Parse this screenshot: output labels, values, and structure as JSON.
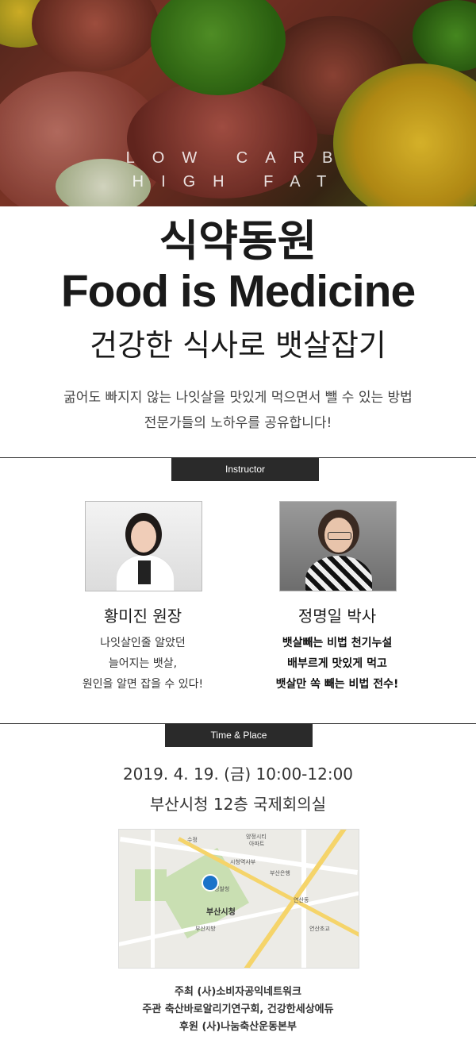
{
  "hero": {
    "line1": "LOW CARB",
    "line2": "HIGH FAT"
  },
  "title_ko": "식약동원",
  "title_en": "Food is Medicine",
  "subtitle": "건강한 식사로 뱃살잡기",
  "description": [
    "굶어도 빠지지 않는 나잇살을 맛있게 먹으면서 뺄 수 있는 방법",
    "전문가들의 노하우를 공유합니다!"
  ],
  "instructor_section": {
    "label": "Instructor",
    "instructors": [
      {
        "name": "황미진 원장",
        "bio": [
          "나잇살인줄 알았던",
          "늘어지는 뱃살,",
          "원인을 알면 잡을 수 있다!"
        ]
      },
      {
        "name": "정명일 박사",
        "bio": [
          "뱃살빼는 비법 천기누설",
          "배부르게 맛있게 먹고",
          "뱃살만 쏙 빼는 비법 전수!"
        ]
      }
    ]
  },
  "time_place_section": {
    "label": "Time & Place",
    "datetime": "2019. 4. 19. (금) 10:00-12:00",
    "place": "부산시청 12층 국제회의실"
  },
  "map": {
    "center_label": "부산시청",
    "labels": [
      "수정",
      "양정시티",
      "아파트",
      "시청역사부",
      "부산은행",
      "연산동",
      "부산시청",
      "경찰청",
      "부산지방",
      "연산초교"
    ]
  },
  "footer": [
    "주최 (사)소비자공익네트워크",
    "주관 축산바로알리기연구회, 건강한세상에듀",
    "후원 (사)나눔축산운동본부"
  ],
  "colors": {
    "tab_bg": "#2a2a2a",
    "text_dark": "#1a1a1a"
  }
}
